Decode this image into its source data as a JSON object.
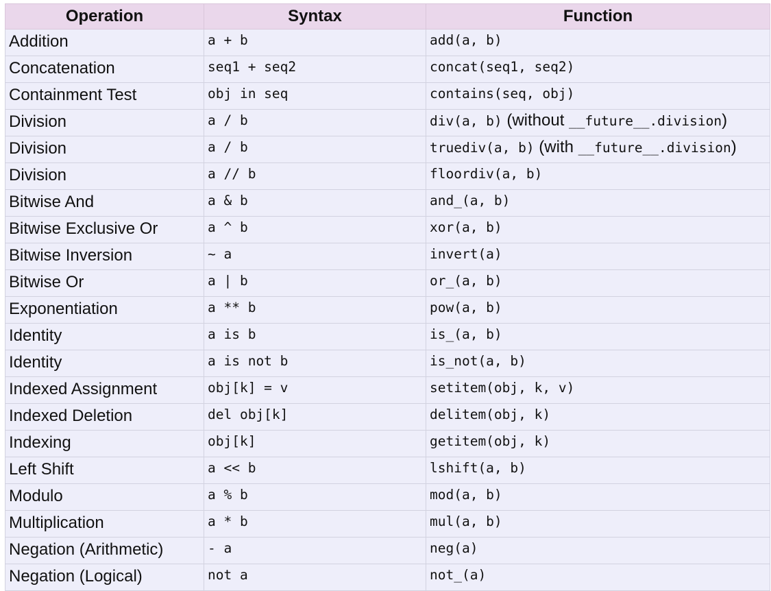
{
  "table": {
    "headers": [
      "Operation",
      "Syntax",
      "Function"
    ],
    "rows": [
      {
        "operation": "Addition",
        "syntax": "a + b",
        "function": "add(a, b)"
      },
      {
        "operation": "Concatenation",
        "syntax": "seq1 + seq2",
        "function": "concat(seq1, seq2)"
      },
      {
        "operation": "Containment Test",
        "syntax": "obj in seq",
        "function": "contains(seq, obj)"
      },
      {
        "operation": "Division",
        "syntax": "a / b",
        "function": "div(a, b)",
        "note_prefix": " (without ",
        "note_code": "__future__.division",
        "note_suffix": ")"
      },
      {
        "operation": "Division",
        "syntax": "a / b",
        "function": "truediv(a, b)",
        "note_prefix": " (with ",
        "note_code": "__future__.division",
        "note_suffix": ")"
      },
      {
        "operation": "Division",
        "syntax": "a // b",
        "function": "floordiv(a, b)"
      },
      {
        "operation": "Bitwise And",
        "syntax": "a & b",
        "function": "and_(a, b)"
      },
      {
        "operation": "Bitwise Exclusive Or",
        "syntax": "a ^ b",
        "function": "xor(a, b)"
      },
      {
        "operation": "Bitwise Inversion",
        "syntax": "~ a",
        "function": "invert(a)"
      },
      {
        "operation": "Bitwise Or",
        "syntax": "a | b",
        "function": "or_(a, b)"
      },
      {
        "operation": "Exponentiation",
        "syntax": "a ** b",
        "function": "pow(a, b)"
      },
      {
        "operation": "Identity",
        "syntax": "a is b",
        "function": "is_(a, b)"
      },
      {
        "operation": "Identity",
        "syntax": "a is not b",
        "function": "is_not(a, b)"
      },
      {
        "operation": "Indexed Assignment",
        "syntax": "obj[k] = v",
        "function": "setitem(obj, k, v)"
      },
      {
        "operation": "Indexed Deletion",
        "syntax": "del obj[k]",
        "function": "delitem(obj, k)"
      },
      {
        "operation": "Indexing",
        "syntax": "obj[k]",
        "function": "getitem(obj, k)"
      },
      {
        "operation": "Left Shift",
        "syntax": "a << b",
        "function": "lshift(a, b)"
      },
      {
        "operation": "Modulo",
        "syntax": "a % b",
        "function": "mod(a, b)"
      },
      {
        "operation": "Multiplication",
        "syntax": "a * b",
        "function": "mul(a, b)"
      },
      {
        "operation": "Negation (Arithmetic)",
        "syntax": "- a",
        "function": "neg(a)"
      },
      {
        "operation": "Negation (Logical)",
        "syntax": "not a",
        "function": "not_(a)"
      }
    ]
  },
  "colors": {
    "header_bg": "#ead7eb",
    "cell_bg": "#eeeefa",
    "border": "#d2d2e0",
    "text": "#111111"
  }
}
